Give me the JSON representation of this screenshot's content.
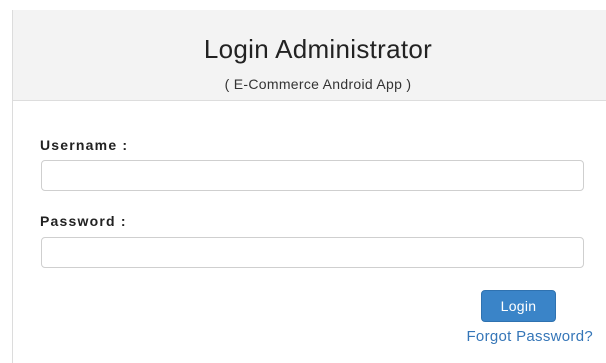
{
  "header": {
    "title": "Login Administrator",
    "subtitle": "( E-Commerce Android App )"
  },
  "form": {
    "username_label": "Username :",
    "username_value": "",
    "password_label": "Password :",
    "password_value": "",
    "login_label": "Login",
    "forgot_label": "Forgot Password?"
  },
  "colors": {
    "header_bg": "#f3f3f3",
    "button_bg": "#3a84c8",
    "link": "#3576b8"
  }
}
